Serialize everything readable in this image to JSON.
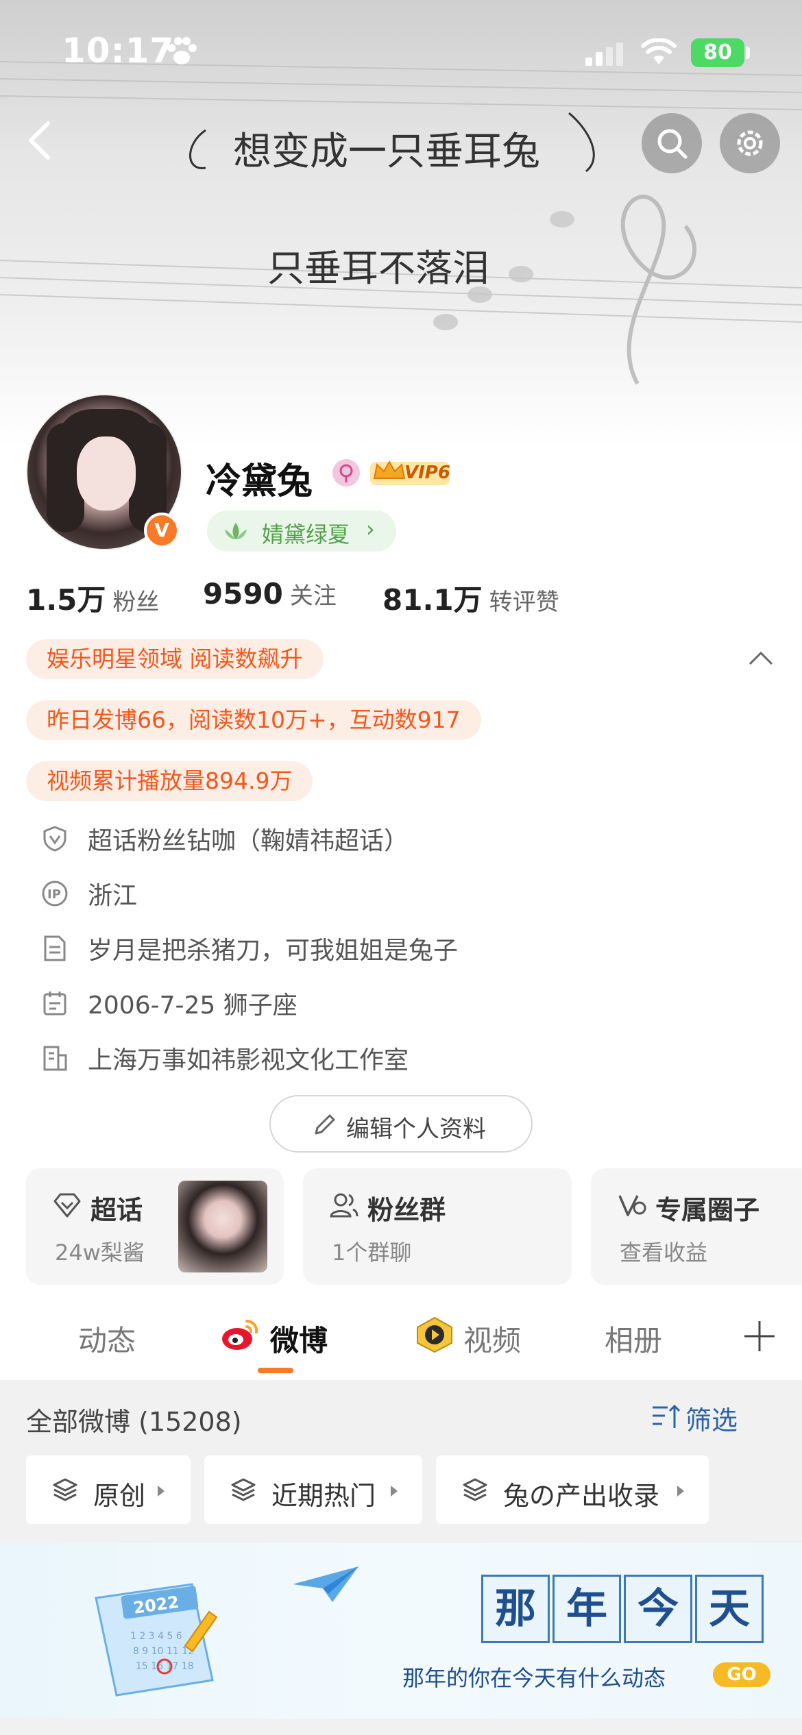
{
  "status_bar": {
    "time": "10:17",
    "battery": "80"
  },
  "banner": {
    "handwriting_line1": "想变成一只垂耳兔",
    "handwriting_line2": "只垂耳不落泪"
  },
  "profile": {
    "name": "冷黛兔",
    "vip_label": "VIP6",
    "verified_mark": "V",
    "tag": "婧黛绿夏",
    "tag_chevron": "›"
  },
  "stats": [
    {
      "num": "1.5万",
      "label": "粉丝"
    },
    {
      "num": "9590",
      "label": "关注"
    },
    {
      "num": "81.1万",
      "label": "转评赞"
    }
  ],
  "hot_tags": [
    "娱乐明星领域 阅读数飙升",
    "昨日发博66，阅读数10万+，互动数917",
    "视频累计播放量894.9万"
  ],
  "info": [
    {
      "icon": "shield-v-icon",
      "text": "超话粉丝钻咖（鞠婧祎超话）"
    },
    {
      "icon": "ip-icon",
      "text": "浙江"
    },
    {
      "icon": "document-icon",
      "text": "岁月是把杀猪刀，可我姐姐是兔子"
    },
    {
      "icon": "calendar-icon",
      "text": "2006-7-25 狮子座"
    },
    {
      "icon": "building-icon",
      "text": "上海万事如祎影视文化工作室"
    }
  ],
  "edit_button": "编辑个人资料",
  "cards": [
    {
      "title": "超话",
      "sub": "24w梨酱",
      "icon": "diamond-icon"
    },
    {
      "title": "粉丝群",
      "sub": "1个群聊",
      "icon": "group-icon"
    },
    {
      "title": "专属圈子",
      "sub": "查看收益",
      "icon": "v-circle-icon"
    }
  ],
  "tabs": [
    "动态",
    "微博",
    "视频",
    "相册"
  ],
  "active_tab": "微博",
  "feed": {
    "title": "全部微博 (15208)",
    "filter": "筛选",
    "chips": [
      "原创",
      "近期热门",
      "兔の产出收录"
    ]
  },
  "promo": {
    "chars": [
      "那",
      "年",
      "今",
      "天"
    ],
    "subtitle": "那年的你在今天有什么动态",
    "go": "GO",
    "year": "2022"
  },
  "colors": {
    "accent": "#f77b27",
    "hot_text": "#f2581d",
    "hot_bg": "#fdeee5",
    "link_blue": "#2b63a8",
    "green_tag": "#57a04e"
  }
}
